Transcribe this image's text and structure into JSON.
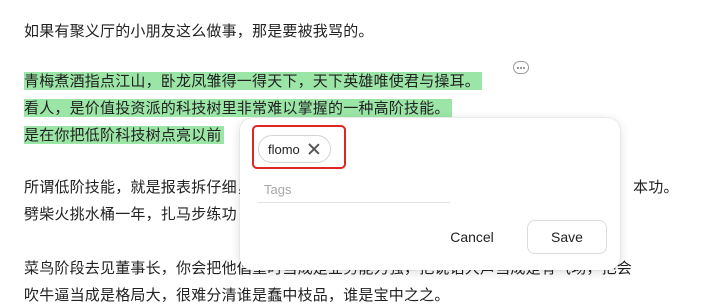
{
  "article": {
    "lines": [
      "如果有聚义厅的小朋友这么做事，那是要被我骂的。",
      "青梅煮酒指点江山，卧龙凤雏得一得天下，天下英雄唯使君与操耳。",
      "看人，是价值投资派的科技树里非常难以掌握的一种高阶技能。",
      "是在你把低阶科技树点亮以前",
      "所谓低阶技能，就是报表拆仔细，",
      "劈柴火挑水桶一年，扎马步练功",
      "菜鸟阶段去见董事长，你会把他倡重时当成是业务能力强，把说话大声当成是有气场，把会",
      "吹牛逼当成是格局大，很难分清谁是蠢中枝品，谁是宝中之之。"
    ],
    "line5_right": "本功。"
  },
  "popup": {
    "tag": "flomo",
    "tags_placeholder": "Tags",
    "tags_value": "",
    "cancel_label": "Cancel",
    "save_label": "Save"
  },
  "colors": {
    "highlight": "#9be6a7",
    "annotation_box": "#e02525"
  }
}
